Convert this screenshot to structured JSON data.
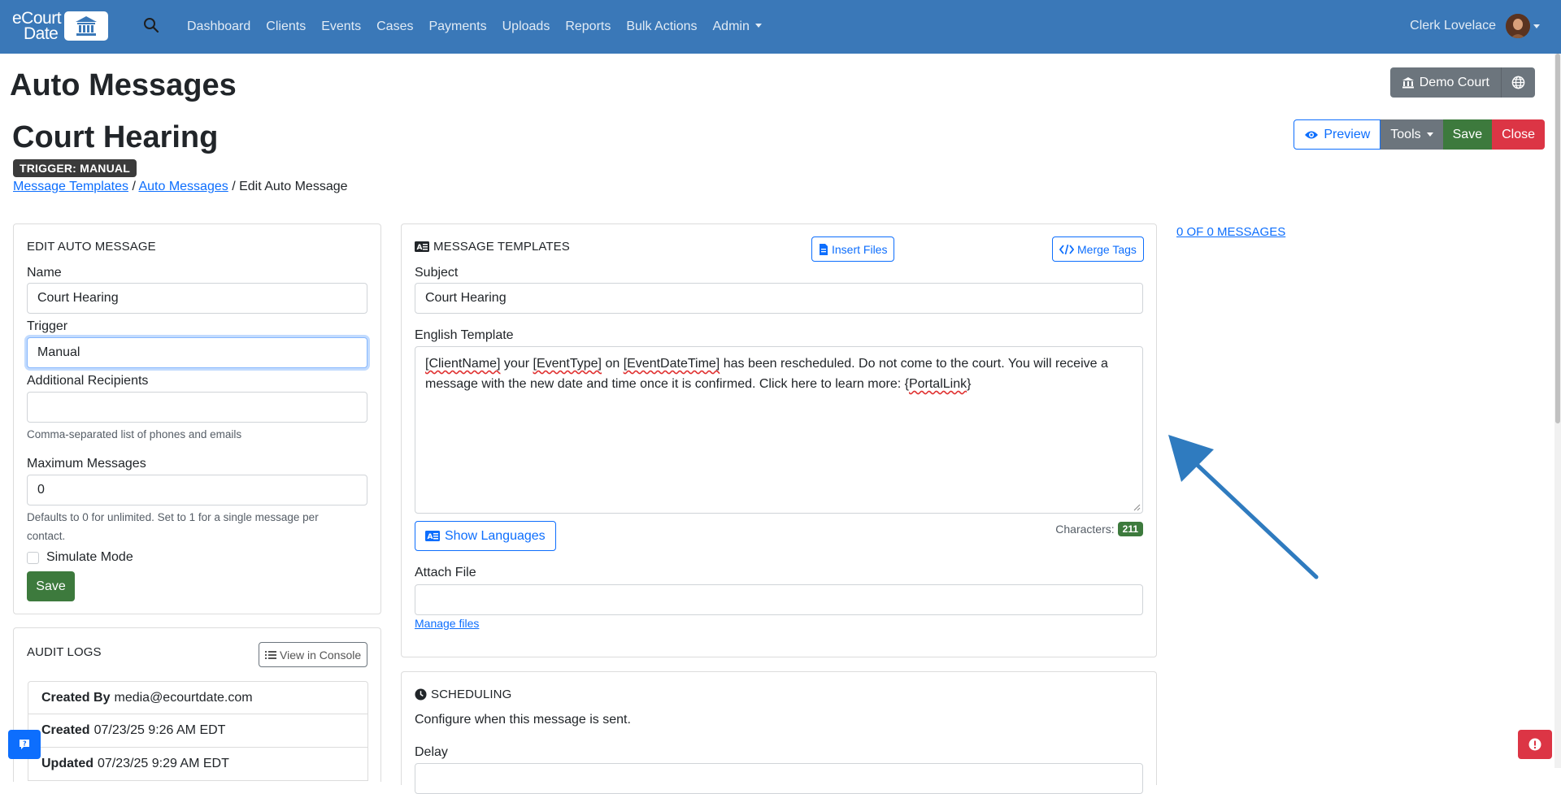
{
  "navbar": {
    "brand_line1": "eCourt",
    "brand_line2": "Date",
    "links": [
      "Dashboard",
      "Clients",
      "Events",
      "Cases",
      "Payments",
      "Uploads",
      "Reports",
      "Bulk Actions",
      "Admin"
    ],
    "user_name": "Clerk Lovelace"
  },
  "header": {
    "page_title": "Auto Messages",
    "record_title": "Court Hearing",
    "trigger_badge": "TRIGGER: MANUAL",
    "breadcrumb": [
      "Message Templates",
      "Auto Messages",
      "Edit Auto Message"
    ],
    "breadcrumb_sep": "/",
    "court_button": "Demo Court",
    "actions": {
      "preview": "Preview",
      "tools": "Tools",
      "save": "Save",
      "close": "Close"
    }
  },
  "edit_card": {
    "title": "EDIT AUTO MESSAGE",
    "name_label": "Name",
    "name_value": "Court Hearing",
    "trigger_label": "Trigger",
    "trigger_value": "Manual",
    "recipients_label": "Additional Recipients",
    "recipients_value": "",
    "recipients_help": "Comma-separated list of phones and emails",
    "max_label": "Maximum Messages",
    "max_value": "0",
    "max_help_1": "Defaults to 0 for unlimited. Set to 1 for a single message per",
    "max_help_2": "contact.",
    "simulate_label": "Simulate Mode",
    "simulate_checked": false,
    "save_label": "Save"
  },
  "audit_card": {
    "title": "AUDIT LOGS",
    "console_button": "View in Console",
    "rows": [
      {
        "label": "Created By",
        "value": "media@ecourtdate.com"
      },
      {
        "label": "Created",
        "value": "07/23/25 9:26 AM EDT"
      },
      {
        "label": "Updated",
        "value": "07/23/25 9:29 AM EDT"
      }
    ]
  },
  "templates_card": {
    "title": "MESSAGE TEMPLATES",
    "insert_files": "Insert Files",
    "merge_tags": "Merge Tags",
    "subject_label": "Subject",
    "subject_value": "Court Hearing",
    "english_label": "English Template",
    "template_parts": {
      "p1": "[ClientName]",
      "p2": " your ",
      "p3": "[EventType]",
      "p4": " on ",
      "p5": "[EventDateTime]",
      "p6": " has been rescheduled. Do not come to the court. You will receive a message with the new date and time once it is confirmed. Click here to learn more: {",
      "p7": "PortalLink",
      "p8": "}"
    },
    "show_languages": "Show Languages",
    "characters_label": "Characters:",
    "characters_count": "211",
    "attach_label": "Attach File",
    "attach_value": "",
    "manage_files": "Manage files"
  },
  "scheduling_card": {
    "title": "SCHEDULING",
    "description": "Configure when this message is sent.",
    "delay_label": "Delay"
  },
  "messages_link": "0 OF 0 MESSAGES",
  "colors": {
    "navbar": "#3a78b8",
    "primary": "#0d6efd",
    "success": "#3d7a3d",
    "danger": "#dc3545",
    "secondary": "#6c757d",
    "annotation_arrow": "#2f7bbf"
  },
  "icons": [
    "bank-icon",
    "search-icon",
    "globe-icon",
    "eye-icon",
    "file-icon",
    "code-icon",
    "language-icon",
    "clock-icon",
    "list-icon",
    "chat-icon",
    "alert-icon",
    "arrow-annotation"
  ]
}
